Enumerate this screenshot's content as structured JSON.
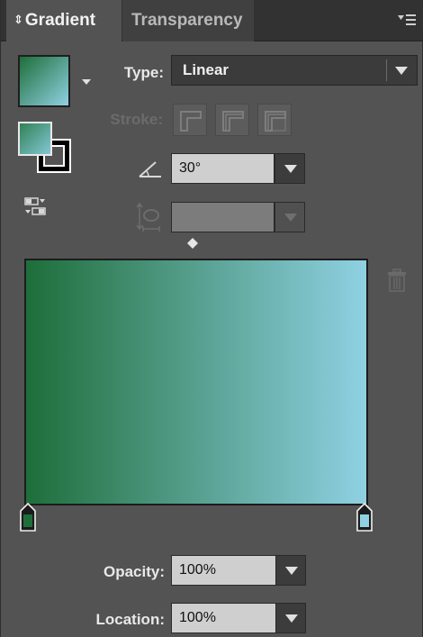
{
  "tabs": {
    "gradient": {
      "label": "Gradient",
      "arrows": "⇕"
    },
    "transparency": {
      "label": "Transparency"
    }
  },
  "type": {
    "label": "Type:",
    "value": "Linear"
  },
  "stroke": {
    "label": "Stroke:"
  },
  "angle": {
    "value": "30°"
  },
  "aspect": {
    "value": ""
  },
  "opacity": {
    "label": "Opacity:",
    "value": "100%"
  },
  "location": {
    "label": "Location:",
    "value": "100%"
  },
  "colors": {
    "gradient_start": "#1e6e3a",
    "gradient_end": "#8fd1e3",
    "panel_bg": "#535353",
    "tabbar_bg": "#323232"
  },
  "icons": {
    "panel_menu": "panel-menu-icon",
    "fill_stroke": "fill-stroke-icon",
    "reverse": "reverse-gradient-icon",
    "angle": "angle-icon",
    "aspect": "aspect-ratio-icon",
    "delete": "trash-icon"
  }
}
